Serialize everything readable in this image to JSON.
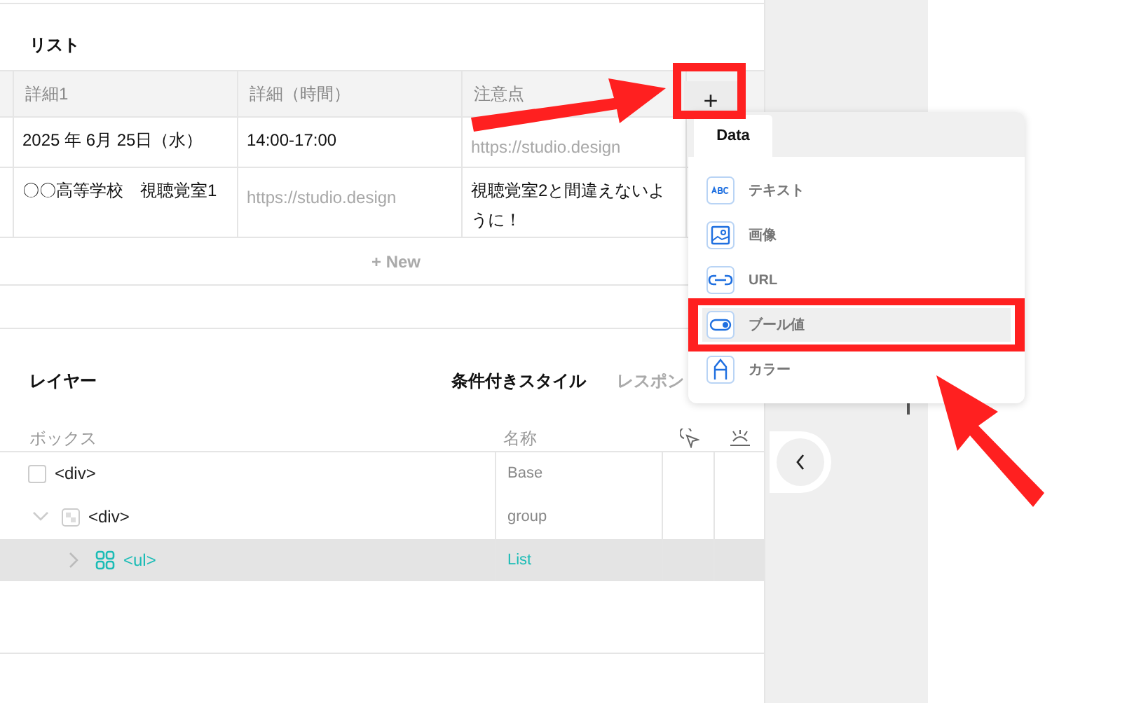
{
  "list": {
    "title": "リスト",
    "columns": [
      "詳細1",
      "詳細（時間）",
      "注意点"
    ],
    "rows": [
      {
        "cells": [
          {
            "text": "2025 年 6月 25日（水）"
          },
          {
            "text": "14:00-17:00"
          },
          {
            "placeholder": "https://studio.design"
          }
        ]
      },
      {
        "cells": [
          {
            "text": "〇〇高等学校　視聴覚室1"
          },
          {
            "placeholder": "https://studio.design"
          },
          {
            "text": "視聴覚室2と間違えないように！"
          }
        ]
      }
    ],
    "add_column": "+",
    "new_row": "+ New"
  },
  "layers": {
    "title": "レイヤー",
    "tabs": [
      {
        "label": "条件付きスタイル",
        "selected": true
      },
      {
        "label": "レスポン",
        "selected": false
      }
    ],
    "columns": [
      "ボックス",
      "名称"
    ],
    "tree": [
      {
        "tag": "<div>",
        "name": "Base",
        "kind": "box",
        "selected": false,
        "children": [
          {
            "tag": "<div>",
            "name": "group",
            "kind": "group",
            "selected": false,
            "expanded": true,
            "children": [
              {
                "tag": "<ul>",
                "name": "List",
                "kind": "list",
                "selected": true,
                "expanded": false
              }
            ]
          }
        ]
      }
    ]
  },
  "menu": {
    "tabs": [
      {
        "label": "Data",
        "selected": true
      }
    ],
    "items": [
      {
        "kind": "text",
        "label": "テキスト",
        "selected": false
      },
      {
        "kind": "image",
        "label": "画像",
        "selected": false
      },
      {
        "kind": "url",
        "label": "URL",
        "selected": false
      },
      {
        "kind": "boolean",
        "label": "ブール値",
        "selected": true
      },
      {
        "kind": "color",
        "label": "カラー",
        "selected": false
      }
    ]
  }
}
